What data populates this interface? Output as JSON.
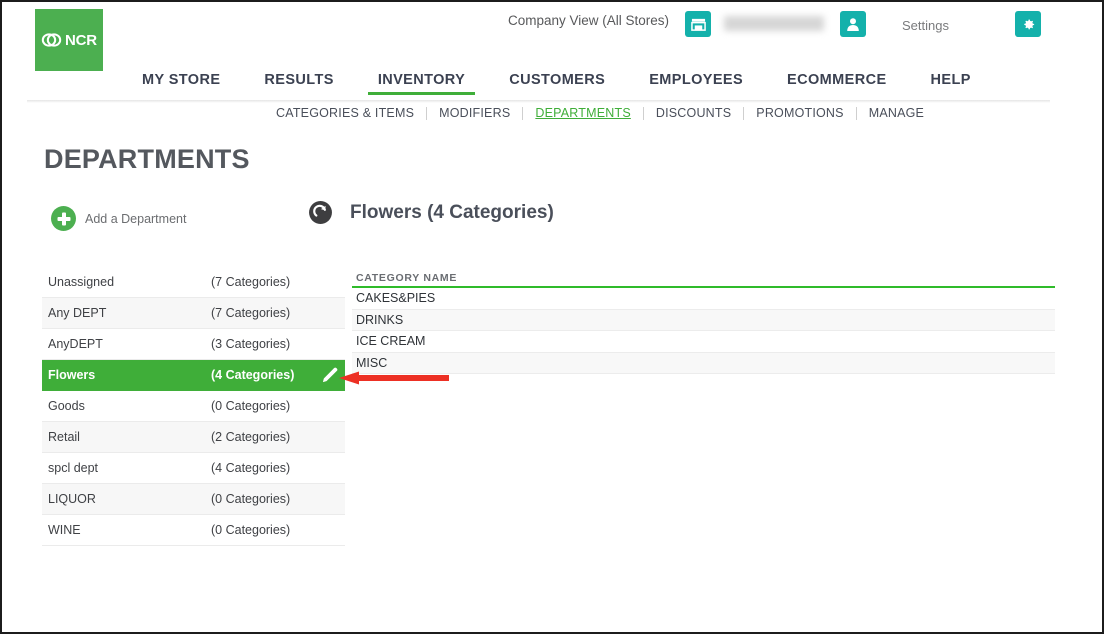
{
  "colors": {
    "brand_green": "#4CAF50",
    "accent_green": "#3fae39",
    "table_green": "#2fbb2a",
    "teal": "#14b1ab",
    "arrow_red": "#ed3024",
    "text_dark": "#3f4145"
  },
  "header": {
    "logo_text": "NCR",
    "company_view": "Company View (All Stores)",
    "store_icon": "store-icon",
    "user_name_masked": "",
    "person_icon": "person-icon",
    "settings_label": "Settings",
    "gear_icon": "gear-icon"
  },
  "main_nav": {
    "items": [
      {
        "label": "MY STORE",
        "active": false
      },
      {
        "label": "RESULTS",
        "active": false
      },
      {
        "label": "INVENTORY",
        "active": true
      },
      {
        "label": "CUSTOMERS",
        "active": false
      },
      {
        "label": "EMPLOYEES",
        "active": false
      },
      {
        "label": "ECOMMERCE",
        "active": false
      },
      {
        "label": "HELP",
        "active": false
      }
    ]
  },
  "sub_nav": {
    "items": [
      {
        "label": "CATEGORIES & ITEMS",
        "active": false
      },
      {
        "label": "MODIFIERS",
        "active": false
      },
      {
        "label": "DEPARTMENTS",
        "active": true
      },
      {
        "label": "DISCOUNTS",
        "active": false
      },
      {
        "label": "PROMOTIONS",
        "active": false
      },
      {
        "label": "MANAGE",
        "active": false
      }
    ]
  },
  "page": {
    "title": "DEPARTMENTS",
    "add_department_label": "Add a Department",
    "add_icon": "plus-circle-icon",
    "detail_refresh_icon": "refresh-icon",
    "detail_title": "Flowers (4 Categories)"
  },
  "departments": {
    "rows": [
      {
        "name": "Unassigned",
        "count": "(7 Categories)",
        "selected": false
      },
      {
        "name": "Any DEPT",
        "count": "(7 Categories)",
        "selected": false
      },
      {
        "name": "AnyDEPT",
        "count": "(3 Categories)",
        "selected": false
      },
      {
        "name": "Flowers",
        "count": "(4 Categories)",
        "selected": true
      },
      {
        "name": "Goods",
        "count": "(0 Categories)",
        "selected": false
      },
      {
        "name": "Retail",
        "count": "(2 Categories)",
        "selected": false
      },
      {
        "name": "spcl dept",
        "count": "(4 Categories)",
        "selected": false
      },
      {
        "name": "LIQUOR",
        "count": "(0 Categories)",
        "selected": false
      },
      {
        "name": "WINE",
        "count": "(0 Categories)",
        "selected": false
      }
    ],
    "edit_icon": "pencil-icon"
  },
  "categories": {
    "header": "CATEGORY NAME",
    "rows": [
      {
        "name": "CAKES&PIES"
      },
      {
        "name": "DRINKS"
      },
      {
        "name": "ICE CREAM"
      },
      {
        "name": "MISC"
      }
    ]
  },
  "annotation": {
    "arrow_icon": "left-arrow-annotation"
  }
}
